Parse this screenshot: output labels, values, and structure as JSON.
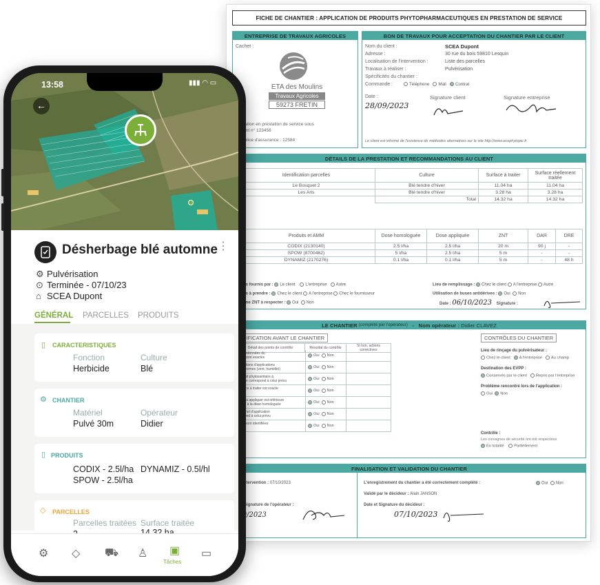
{
  "doc": {
    "title": "FICHE DE CHANTIER : APPLICATION DE PRODUITS PHYTOPHARMACEUTIQUES EN PRESTATION DE SERVICE",
    "entreprise": {
      "header": "ENTREPRISE DE TRAVAUX AGRICOLES",
      "cachet": "Cachet :",
      "logo_name": "ETA des Moulins",
      "logo_sub": "Travaux Agricoles",
      "logo_city": "59273 FRETIN",
      "agrement": "pplication en prestation de service sous\nrément n° 123456",
      "police": "de police d'assurance : 12584"
    },
    "bon": {
      "header": "BON DE TRAVAUX POUR ACCEPTATION DU CHANTIER PAR LE CLIENT",
      "nom_label": "Nom du client :",
      "nom": "SCEA Dupont",
      "adresse_label": "Adresse :",
      "adresse": "30 rue du bois 59810 Lesquin",
      "loc_label": "Localisation de l'intervention :",
      "loc": "Liste des parcelles",
      "travaux_label": "Travaux à réaliser :",
      "travaux": "Pulvérisation",
      "spec_label": "Spécificités du chantier :",
      "commande_label": "Commande :",
      "commande_opts": [
        "Téléphone",
        "Mail",
        "Contrat"
      ],
      "date_label": "Date :",
      "date": "28/09/2023",
      "sig_client": "Signature client",
      "sig_ent": "Signature entreprise",
      "note": "Le client est informé de l'existence de méthodes alternatives sur le site http://www.ecophytopic.fr"
    },
    "details": {
      "header": "DÉTAILS DE LA PRESTATION ET RECOMMANDATIONS AU CLIENT",
      "parc_cols": [
        "Identification parcelles",
        "Culture",
        "Surface à traiter",
        "Surface réellement traitée"
      ],
      "parc_rows": [
        [
          "Le Bosquet 2",
          "Blé tendre d'hiver",
          "11.04 ha",
          "11.04 ha"
        ],
        [
          "Les Aris",
          "Blé tendre d'hiver",
          "3.28 ha",
          "3.28 ha"
        ]
      ],
      "total_label": "Total",
      "total_a": "14.32 ha",
      "total_b": "14.32 ha",
      "prod_cols": [
        "Produits et AMM",
        "Dose homologuée",
        "Dose appliquée",
        "ZNT",
        "DAR",
        "DRE"
      ],
      "prod_rows": [
        [
          "CODIX (2130140)",
          "2.5 l/ha",
          "2.5 l/ha",
          "20 m",
          "90 j",
          "-"
        ],
        [
          "SPOW (8700462)",
          "5 l/ha",
          "2.5 l/ha",
          "5 m",
          "-",
          "-"
        ],
        [
          "DYNAMIZ (2170276)",
          "0.1 l/ha",
          "0.1 l/ha",
          "5 m",
          "-",
          "48 h"
        ]
      ],
      "fournis_label": "oduits fournis par :",
      "fournis_opts": [
        "Le client",
        "L'entreprise",
        "Autre"
      ],
      "prendre_label": "oduits à prendre :",
      "prendre_opts": [
        "Chez le client",
        "A l'entreprise",
        "Chez le fournisseur"
      ],
      "znt_label": "-t-il une ZNT à respecter :",
      "znt_opts": [
        "Oui",
        "Non"
      ],
      "remplissage_label": "Lieu de remplissage :",
      "remplissage_opts": [
        "Chez le client",
        "A l'entreprise",
        "Autre"
      ],
      "buses_label": "Utilisation de buses antidérives :",
      "buses_opts": [
        "Oui",
        "Non"
      ],
      "date2_label": "Date :",
      "date2": "06/10/2023",
      "signature_label": "Signature :"
    },
    "chantier": {
      "header": "LE CHANTIER",
      "header_note": "(complété par l'opérateur)",
      "sep": "-",
      "operateur_label": "Nom opérateur :",
      "operateur": "Didier CLAVEZ",
      "verif": "ERIFICATION AVANT LE CHANTIER",
      "verif_cols": [
        "Détail des points de contrôle",
        "Résultat du contrôle",
        "Si non, actions correctives"
      ],
      "verif_rows": [
        "s coordonnées du\nntier sont exactes",
        "conditions d'applications\nt conformes (vent, humidité)",
        "produit phytosanitaire à\npliquer correspond à celui prévu",
        "surface à traiter est exacte",
        "dose à appliquer est inférieure\négale à la dose homologuée",
        "matériel d'application\nrespond à celui prévu",
        "ZNT sont identifiées"
      ],
      "oui": "Oui",
      "non": "Non",
      "controles": "CONTRÔLES DU CHANTIER",
      "rincage_label": "Lieu de rinçage du pulvérisateur :",
      "rincage_opts": [
        "Chez le client",
        "A l'entreprise",
        "Au champ"
      ],
      "evpp_label": "Destination des EVPP :",
      "evpp_opts": [
        "Conservés par le client",
        "Repris par l'entreprise"
      ],
      "probleme_label": "Problème rencontré lors de l'application :",
      "probleme_opts": [
        "Oui",
        "Non"
      ],
      "controle_label": "Contrôle :",
      "controle_text": "Les consignes de sécurité ont été respectées",
      "controle_opts": [
        "En totalité",
        "Partiellement"
      ]
    },
    "finalisation": {
      "header": "FINALISATION ET VALIDATION DU CHANTIER",
      "intervention_label": "e d'intervention :",
      "intervention": "07/10/2023",
      "sig_op_label": "e et Signature de l'opérateur :",
      "sig_op_date": "/10/2023",
      "enreg_label": "L'enregistrement du chantier a été correctement complété :",
      "enreg_opts": [
        "Oui",
        "Non"
      ],
      "valide_label": "Validé par le décideur :",
      "valide": "Alain JANSON",
      "date_dec_label": "Date et Signature du décideur :",
      "date_dec": "07/10/2023"
    }
  },
  "phone": {
    "time": "13:58",
    "title": "Désherbage blé automne",
    "info": [
      "Pulvérisation",
      "Terminée - 07/10/23",
      "SCEA Dupont"
    ],
    "tabs": [
      "GÉNÉRAL",
      "PARCELLES",
      "PRODUITS"
    ],
    "caract": {
      "title": "CARACTERISTIQUES",
      "fonction_label": "Fonction",
      "fonction": "Herbicide",
      "culture_label": "Culture",
      "culture": "Blé"
    },
    "chantier": {
      "title": "CHANTIER",
      "materiel_label": "Matériel",
      "materiel": "Pulvé 30m",
      "operateur_label": "Opérateur",
      "operateur": "Didier"
    },
    "produits": {
      "title": "PRODUITS",
      "p1": "CODIX - 2.5l/ha",
      "p2": "DYNAMIZ - 0.5l/hl",
      "p3": "SPOW - 2.5l/ha"
    },
    "parcelles": {
      "title": "PARCELLES",
      "traitees_label": "Parcelles traitées",
      "traitees": "2",
      "surface_label": "Surface traitée",
      "surface": "14.32 ha"
    },
    "bottom_tab_active": "Tâches",
    "accent": "#7cae3a",
    "teal": "#4ba9a2"
  }
}
